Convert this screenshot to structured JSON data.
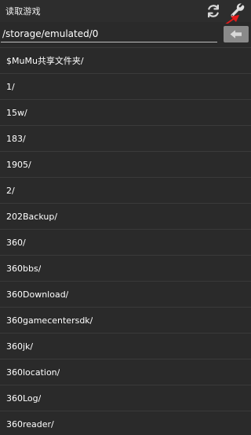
{
  "header": {
    "title": "读取游戏",
    "refresh_icon": "refresh-icon",
    "settings_icon": "wrench-icon",
    "annotation_color": "#e51a1a"
  },
  "path": {
    "value": "/storage/emulated/0",
    "back_icon": "arrow-left-icon"
  },
  "files": [
    "$MuMu共享文件夹/",
    "1/",
    "15w/",
    "183/",
    "1905/",
    "2/",
    "202Backup/",
    "360/",
    "360bbs/",
    "360Download/",
    "360gamecentersdk/",
    "360jk/",
    "360location/",
    "360Log/",
    "360reader/"
  ],
  "colors": {
    "background": "#2a2a2a",
    "divider": "#3a3a3a",
    "text": "#ffffff",
    "back_button": "#8a8a8a"
  }
}
